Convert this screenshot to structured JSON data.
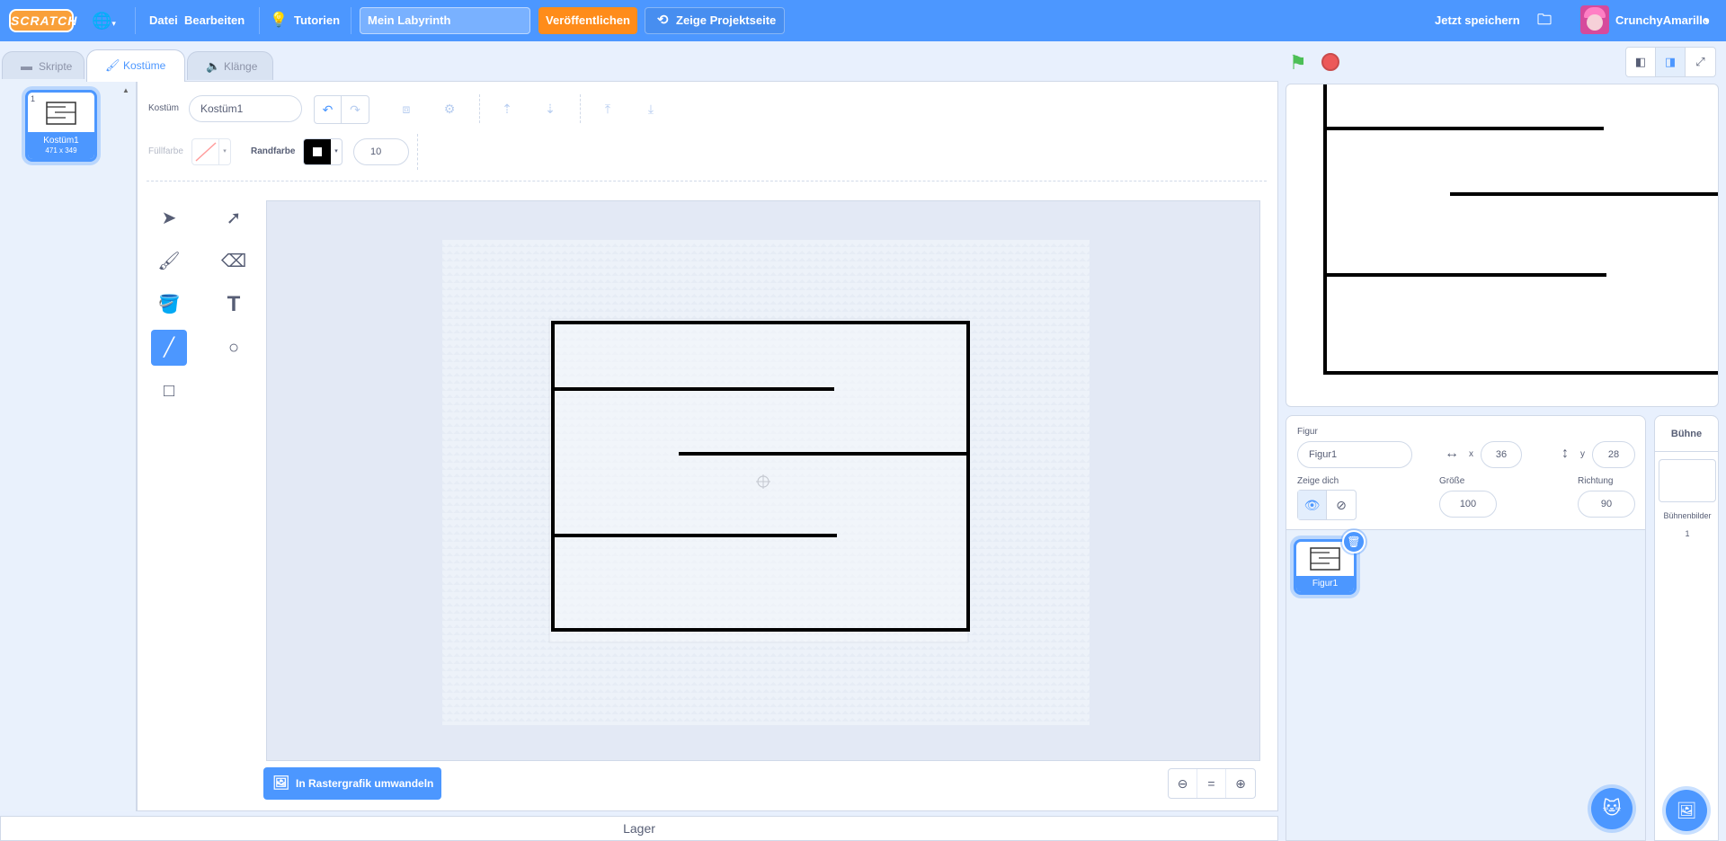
{
  "menubar": {
    "logo": "SCRATCH",
    "file": "Datei",
    "edit": "Bearbeiten",
    "tutorials": "Tutorien",
    "project_title": "Mein Labyrinth",
    "share": "Veröffentlichen",
    "see_project_page": "Zeige Projektseite",
    "save_now": "Jetzt speichern",
    "username": "CrunchyAmarillo"
  },
  "tabs": {
    "code": "Skripte",
    "costumes": "Kostüme",
    "sounds": "Klänge"
  },
  "costume_list": {
    "items": [
      {
        "number": "1",
        "name": "Kostüm1",
        "size": "471 x 349"
      }
    ]
  },
  "paint_editor": {
    "costume_label": "Kostüm",
    "costume_name": "Kostüm1",
    "fill_label": "Füllfarbe",
    "outline_label": "Randfarbe",
    "outline_width": "10",
    "convert_button": "In Rastergrafik umwandeln",
    "zoom_reset": "="
  },
  "lager_label": "Lager",
  "sprite_info": {
    "sprite_label": "Figur",
    "sprite_name": "Figur1",
    "x_label": "x",
    "x_value": "36",
    "y_label": "y",
    "y_value": "28",
    "show_label": "Zeige dich",
    "size_label": "Größe",
    "size_value": "100",
    "direction_label": "Richtung",
    "direction_value": "90"
  },
  "sprites": [
    {
      "name": "Figur1"
    }
  ],
  "stage_selector": {
    "header": "Bühne",
    "backdrops_label": "Bühnenbilder",
    "backdrops_count": "1"
  },
  "colors": {
    "menubar": "#4c97ff",
    "share": "#ff8c1a",
    "accent": "#4c97ff",
    "flag": "#4cbf56",
    "stop": "#ec5959"
  },
  "icons": [
    "globe-icon",
    "lightbulb-icon",
    "folder-icon",
    "green-flag-icon",
    "stop-icon",
    "brush-icon",
    "cat-add-icon"
  ]
}
